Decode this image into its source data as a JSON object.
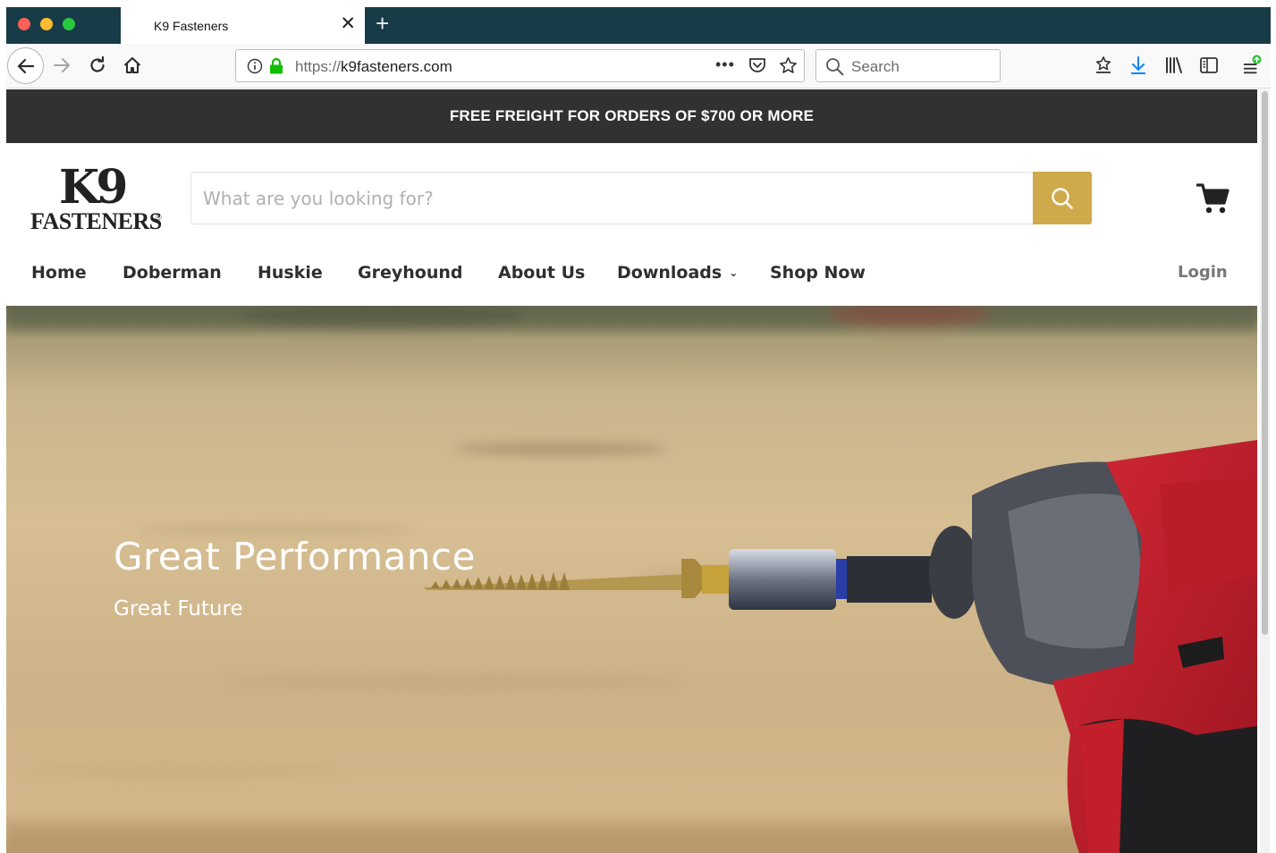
{
  "browser": {
    "tab_title": "K9 Fasteners",
    "url_protocol": "https://",
    "url_host": "k9fasteners.com",
    "search_placeholder": "Search"
  },
  "promo_bar": {
    "text": "FREE FREIGHT FOR ORDERS OF $700 OR MORE"
  },
  "logo": {
    "mark": "K9",
    "wordmark": "FASTENERS",
    "registered": "®"
  },
  "site_search": {
    "placeholder": "What are you looking for?"
  },
  "nav": {
    "items": [
      {
        "label": "Home"
      },
      {
        "label": "Doberman"
      },
      {
        "label": "Huskie"
      },
      {
        "label": "Greyhound"
      },
      {
        "label": "About Us"
      },
      {
        "label": "Downloads",
        "has_dropdown": true
      },
      {
        "label": "Shop Now"
      }
    ],
    "login_label": "Login"
  },
  "hero": {
    "title": "Great Performance",
    "subtitle": "Great Future"
  },
  "colors": {
    "tabbar": "#173b47",
    "promo_bg": "#313131",
    "search_button": "#cfaa4a",
    "drill_red": "#c41e2a"
  },
  "icons": [
    "back-arrow-icon",
    "forward-arrow-icon",
    "reload-icon",
    "home-icon",
    "info-icon",
    "lock-icon",
    "more-icon",
    "pocket-icon",
    "bookmark-star-icon",
    "search-icon",
    "reading-list-icon",
    "download-icon",
    "library-icon",
    "sidebar-icon",
    "menu-icon",
    "cart-icon"
  ]
}
